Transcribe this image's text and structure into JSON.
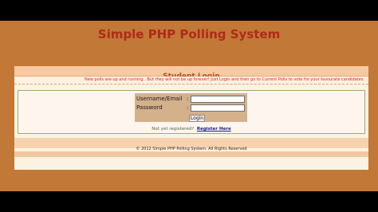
{
  "site": {
    "title": "Simple PHP Polling System"
  },
  "login": {
    "heading": "Student Login",
    "notice": "New polls are up and running.. But they will not be up forever! Just Login and then go to Current Polls to vote for your favourate candidates.",
    "username_label": "Username/Email",
    "password_label": "Password",
    "colon": ":",
    "username_value": "",
    "password_value": "",
    "login_button": "Login",
    "register_prompt": "Not yet registered?",
    "register_link": "Register Here"
  },
  "footer": {
    "copyright": "© 2012 Simple PHP Polling System. All Rights Reserved"
  }
}
